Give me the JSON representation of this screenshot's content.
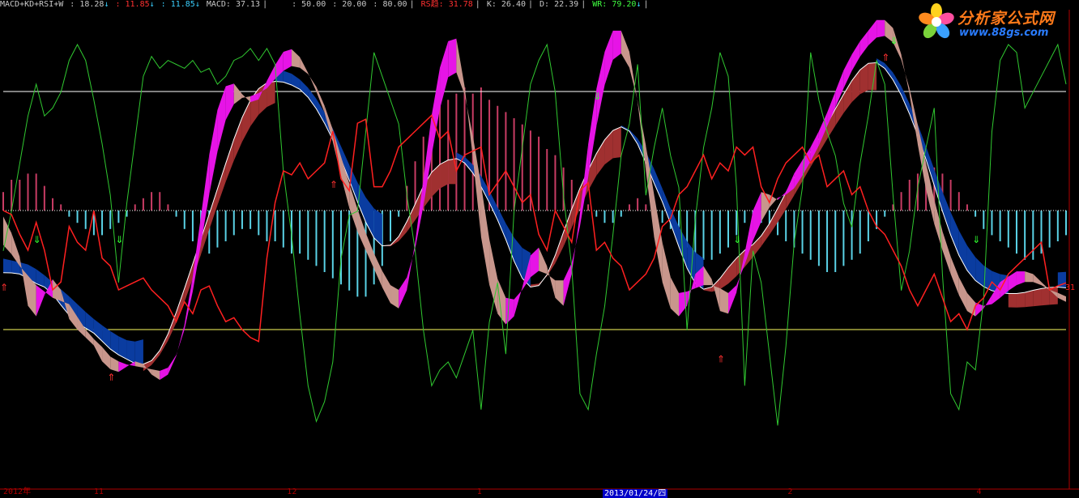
{
  "legend": {
    "formula": "MACD+KD+RSI+W",
    "items": [
      {
        "text": ": 18.28",
        "color": "#c8c8c8",
        "arrow": "↓",
        "arrow_color": "#3ad0ff"
      },
      {
        "text": ": 11.85",
        "color": "#ff3030",
        "arrow": "↓",
        "arrow_color": "#3ad0ff"
      },
      {
        "text": ": 11.85",
        "color": "#3ad0ff",
        "arrow": "↓",
        "arrow_color": "#3ad0ff"
      },
      {
        "text": "MACD: 37.13",
        "color": "#c8c8c8",
        "arrow": "",
        "arrow_color": "#c8c8c8"
      },
      {
        "text": ": 50.00",
        "color": "#c8c8c8",
        "arrow": "",
        "arrow_color": "#c8c8c8"
      },
      {
        "text": ": 20.00",
        "color": "#c8c8c8",
        "arrow": "",
        "arrow_color": "#c8c8c8"
      },
      {
        "text": ": 80.00",
        "color": "#c8c8c8",
        "arrow": "",
        "arrow_color": "#c8c8c8"
      },
      {
        "text": "RS趋: 31.78",
        "color": "#ff3030",
        "arrow": "",
        "arrow_color": "#c8c8c8"
      },
      {
        "text": "K: 26.40",
        "color": "#c8c8c8",
        "arrow": "",
        "arrow_color": "#c8c8c8"
      },
      {
        "text": "D: 22.39",
        "color": "#c8c8c8",
        "arrow": "",
        "arrow_color": "#c8c8c8"
      },
      {
        "text": "WR: 79.20",
        "color": "#40ff40",
        "arrow": "↓",
        "arrow_color": "#3ad0ff"
      }
    ]
  },
  "logo": {
    "main": "分析家公式网",
    "url": "www.88gs.com"
  },
  "x_axis": {
    "labels": [
      {
        "text": "2012年",
        "pos": 0.003
      },
      {
        "text": "11",
        "pos": 0.087
      },
      {
        "text": "12",
        "pos": 0.266
      },
      {
        "text": "1",
        "pos": 0.442
      },
      {
        "text": "2",
        "pos": 0.73
      },
      {
        "text": "4",
        "pos": 0.905
      }
    ],
    "highlight": "2013/01/24/四"
  },
  "rs_end_label": "31",
  "colors": {
    "background": "#000000",
    "hist_pos": "#c83c64",
    "hist_neg": "#5ad2e6",
    "wr_line": "#30c830",
    "rs_line": "#ff2020",
    "magenta": "#e614e6",
    "rosy": "#c8968c",
    "darkred": "#a03030",
    "blue": "#0a3ca0",
    "white": "#ffffff",
    "yellow": "#ffff60"
  },
  "chart_data": {
    "type": "line",
    "levels": [
      80,
      50,
      20
    ],
    "n": 130,
    "macd_hist": [
      3,
      5,
      5,
      6,
      6,
      4,
      2,
      1,
      -1,
      -2,
      -3,
      -4,
      -4,
      -3,
      -2,
      -1,
      1,
      2,
      3,
      3,
      1,
      -1,
      -3,
      -5,
      -6,
      -7,
      -6,
      -5,
      -4,
      -3,
      -3,
      -4,
      -5,
      -5,
      -6,
      -7,
      -7,
      -8,
      -9,
      -10,
      -11,
      -12,
      -13,
      -14,
      -14,
      -12,
      -9,
      -5,
      -1,
      4,
      8,
      12,
      15,
      17,
      18,
      19,
      20,
      19,
      20,
      18,
      17,
      16,
      15,
      14,
      13,
      12,
      10,
      9,
      7,
      5,
      3,
      1,
      -1,
      -2,
      -2,
      -1,
      1,
      2,
      1,
      -1,
      -2,
      -3,
      -5,
      -6,
      -7,
      -8,
      -8,
      -7,
      -6,
      -4,
      -2,
      -1,
      -2,
      -3,
      -4,
      -5,
      -6,
      -7,
      -8,
      -9,
      -10,
      -10,
      -9,
      -8,
      -7,
      -5,
      -3,
      -1,
      1,
      3,
      5,
      6,
      7,
      7,
      6,
      5,
      3,
      1,
      -1,
      -3,
      -4,
      -5,
      -6,
      -7,
      -8,
      -8,
      -7,
      -6,
      -5,
      -4
    ],
    "wr": [
      48,
      58,
      70,
      82,
      90,
      82,
      84,
      88,
      96,
      100,
      96,
      86,
      75,
      62,
      40,
      60,
      76,
      92,
      97,
      94,
      96,
      95,
      94,
      96,
      93,
      94,
      90,
      92,
      96,
      97,
      99,
      96,
      99,
      95,
      68,
      52,
      32,
      14,
      5,
      10,
      20,
      46,
      57,
      58,
      78,
      98,
      92,
      86,
      80,
      62,
      48,
      28,
      14,
      18,
      20,
      16,
      22,
      28,
      8,
      30,
      40,
      22,
      58,
      74,
      90,
      96,
      100,
      88,
      62,
      44,
      12,
      8,
      22,
      34,
      52,
      72,
      80,
      95,
      62,
      74,
      84,
      72,
      64,
      28,
      56,
      74,
      84,
      98,
      92,
      64,
      14,
      48,
      40,
      22,
      4,
      24,
      50,
      64,
      98,
      86,
      78,
      72,
      60,
      54,
      70,
      82,
      96,
      90,
      62,
      38,
      48,
      64,
      74,
      84,
      42,
      12,
      8,
      20,
      18,
      36,
      78,
      96,
      100,
      98,
      84,
      88,
      92,
      96,
      100,
      90
    ],
    "rs": [
      50,
      49,
      44,
      40,
      47,
      40,
      30,
      32,
      46,
      42,
      40,
      50,
      38,
      36,
      30,
      31,
      32,
      33,
      30,
      28,
      26,
      22,
      27,
      24,
      30,
      31,
      26,
      22,
      23,
      20,
      18,
      17,
      38,
      52,
      60,
      59,
      62,
      58,
      60,
      62,
      70,
      58,
      55,
      72,
      73,
      56,
      56,
      60,
      66,
      68,
      70,
      72,
      74,
      68,
      70,
      60,
      64,
      65,
      66,
      54,
      57,
      60,
      56,
      52,
      54,
      44,
      40,
      50,
      46,
      42,
      55,
      57,
      40,
      42,
      38,
      36,
      30,
      32,
      34,
      38,
      46,
      48,
      54,
      56,
      60,
      64,
      58,
      62,
      60,
      66,
      64,
      66,
      56,
      52,
      58,
      62,
      64,
      66,
      62,
      64,
      56,
      58,
      60,
      54,
      56,
      50,
      46,
      44,
      40,
      36,
      30,
      26,
      30,
      34,
      28,
      22,
      24,
      20,
      26,
      28,
      32,
      30,
      34,
      36,
      38,
      40,
      42,
      30,
      31,
      31.78
    ],
    "k": [
      42,
      55,
      36,
      24,
      18,
      28,
      40,
      30,
      20,
      18,
      22,
      14,
      12,
      10,
      8,
      10,
      14,
      12,
      8,
      6,
      8,
      12,
      20,
      32,
      48,
      66,
      78,
      82,
      84,
      80,
      74,
      78,
      82,
      88,
      90,
      92,
      90,
      84,
      80,
      76,
      68,
      58,
      50,
      44,
      40,
      36,
      30,
      26,
      24,
      26,
      40,
      60,
      74,
      88,
      96,
      94,
      90,
      60,
      40,
      30,
      24,
      18,
      22,
      30,
      40,
      46,
      36,
      26,
      22,
      30,
      50,
      68,
      82,
      92,
      96,
      98,
      92,
      80,
      60,
      40,
      30,
      26,
      20,
      24,
      34,
      44,
      30,
      24,
      20,
      28,
      40,
      50,
      60,
      54,
      48,
      56,
      60,
      62,
      66,
      70,
      74,
      80,
      86,
      90,
      92,
      96,
      98,
      100,
      96,
      92,
      80,
      66,
      54,
      46,
      40,
      34,
      28,
      24,
      22,
      24,
      30,
      32,
      34,
      34,
      36,
      34,
      32,
      30,
      28,
      26
    ],
    "d": [
      38,
      46,
      40,
      32,
      24,
      26,
      34,
      32,
      24,
      20,
      22,
      18,
      16,
      12,
      10,
      10,
      12,
      12,
      10,
      8,
      8,
      10,
      16,
      26,
      40,
      56,
      70,
      78,
      80,
      80,
      76,
      78,
      80,
      84,
      86,
      88,
      88,
      86,
      82,
      78,
      72,
      64,
      56,
      48,
      44,
      40,
      34,
      30,
      26,
      26,
      34,
      50,
      66,
      80,
      90,
      92,
      90,
      72,
      52,
      38,
      30,
      22,
      22,
      28,
      36,
      42,
      38,
      30,
      24,
      28,
      42,
      60,
      76,
      86,
      92,
      94,
      92,
      84,
      68,
      50,
      38,
      30,
      24,
      24,
      30,
      40,
      34,
      28,
      24,
      26,
      34,
      44,
      54,
      54,
      50,
      52,
      56,
      58,
      62,
      66,
      70,
      76,
      82,
      86,
      90,
      92,
      94,
      96,
      96,
      92,
      84,
      72,
      60,
      50,
      44,
      38,
      32,
      28,
      24,
      24,
      26,
      28,
      30,
      32,
      33,
      33,
      32,
      30,
      28,
      27
    ]
  }
}
